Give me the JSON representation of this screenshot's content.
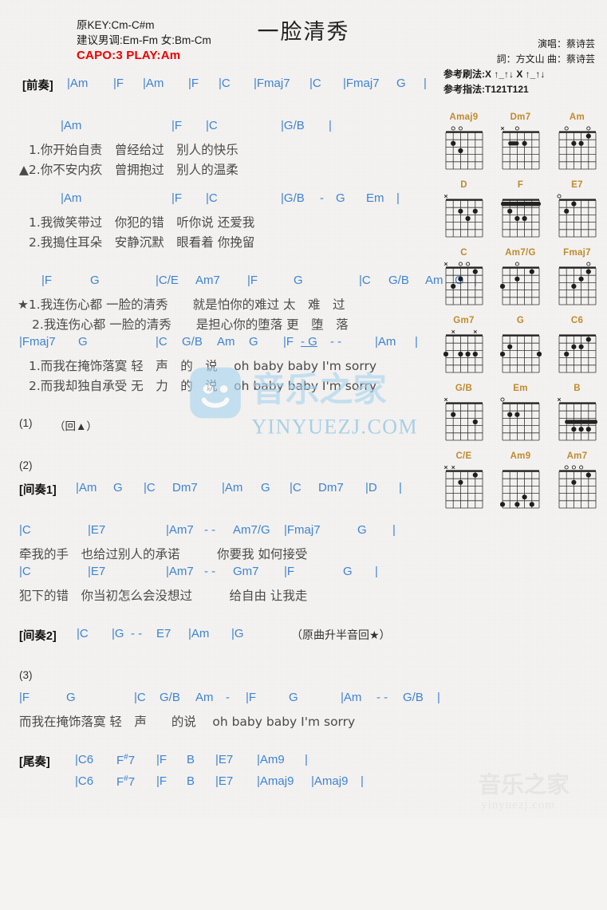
{
  "header": {
    "orig_key": "原KEY:Cm-C#m",
    "suggest_key": "建议男调:Em-Fm 女:Bm-Cm",
    "capo": "CAPO:3 PLAY:Am",
    "title": "一脸清秀",
    "singer": "演唱：蔡诗芸",
    "credits": "詞：方文山   曲：蔡诗芸",
    "strum": "参考刷法:X ↑_↑↓ X ↑_↑↓",
    "fingering": "参考指法:T121T121"
  },
  "sections": {
    "intro_label": "[前奏]",
    "interlude1_label": "[间奏1]",
    "interlude2_label": "[间奏2]",
    "outro_label": "[尾奏]",
    "repeat1": "(1)",
    "repeat1_note": "（回▲）",
    "repeat2": "(2)",
    "repeat3": "(3)",
    "interlude2_note": "（原曲升半音回★）"
  },
  "lines": {
    "intro_chords": [
      "|Am",
      "|F",
      "|Am",
      "|F",
      "|C",
      "|Fmaj7",
      "|C",
      "|Fmaj7",
      "G",
      "|"
    ],
    "v1_chords": [
      "|Am",
      "|F",
      "|C",
      "|G/B",
      "|"
    ],
    "v1_lyric1": "1.你开始自责　曾经给过　别人的快乐",
    "v1_lyric2": "▲2.你不安内疚　曾拥抱过　别人的温柔",
    "v2_chords": [
      "|Am",
      "|F",
      "|C",
      "|G/B",
      "-",
      "G",
      "Em",
      "|"
    ],
    "v2_lyric1": "1.我微笑带过　你犯的错　听你说 还爱我",
    "v2_lyric2": "2.我搗住耳朵　安静沉默　眼看着 你挽留",
    "c1_chords": [
      "|F",
      "G",
      "|C/E",
      "Am7",
      "|F",
      "G",
      "|C",
      "G/B",
      "Am",
      "G",
      "|"
    ],
    "c1_lyric1": "★1.我连伤心都 一脸的清秀　　就是怕你的难过 太　难　过",
    "c1_lyric2": "2.我连伤心都 一脸的清秀　　是担心你的堕落 更　堕　落",
    "c2_chords": [
      "|Fmaj7",
      "G",
      "|C",
      "G/B",
      "Am",
      "G",
      "|F",
      "- G",
      "- -",
      "|Am",
      "|"
    ],
    "c2_lyric1": "1.而我在掩饰落寞 轻　声　的　说　 oh baby baby I'm sorry",
    "c2_lyric2": "2.而我却独自承受 无　力　的　说　 oh baby baby I'm sorry",
    "i1_chords": [
      "|Am",
      "G",
      "|C",
      "Dm7",
      "|Am",
      "G",
      "|C",
      "Dm7",
      "|D",
      "|"
    ],
    "b1_chords": [
      "|C",
      "|E7",
      "|Am7",
      "- -",
      "Am7/G",
      "|Fmaj7",
      "G",
      "|"
    ],
    "b1_lyric": "牵我的手　也给过别人的承诺　　　你要我 如何接受",
    "b2_chords": [
      "|C",
      "|E7",
      "|Am7",
      "- -",
      "Gm7",
      "|F",
      "G",
      "|"
    ],
    "b2_lyric": "犯下的错　你当初怎么会没想过　　　给自由 让我走",
    "i2_chords": [
      "|C",
      "|G",
      "- -",
      "E7",
      "|Am",
      "|G",
      "|"
    ],
    "f_chords": [
      "|F",
      "G",
      "|C",
      "G/B",
      "Am",
      "-",
      "|F",
      "G",
      "|Am",
      "- -",
      "G/B",
      "|"
    ],
    "f_lyric": "而我在掩饰落寞 轻　声　　的说　 oh baby baby I'm sorry",
    "outro1_chords": [
      "|C6",
      "F#7",
      "|F",
      "B",
      "|E7",
      "|Am9",
      "|"
    ],
    "outro2_chords": [
      "|C6",
      "F#7",
      "|F",
      "B",
      "|E7",
      "|Amaj9",
      "|Amaj9",
      "|"
    ]
  },
  "chord_diagrams": [
    {
      "name": "Amaj9",
      "markers": "_oo__",
      "dots": [
        [
          5,
          2,
          2
        ],
        [
          4,
          3,
          1
        ]
      ],
      "barre": null
    },
    {
      "name": "Dm7",
      "markers": "x_o__",
      "dots": [
        [
          3,
          2,
          2
        ]
      ],
      "barre": {
        "fret": 1,
        "from": 1,
        "to": 2
      }
    },
    {
      "name": "Am",
      "markers": "_o__o",
      "dots": [
        [
          4,
          2,
          2
        ],
        [
          3,
          2,
          1
        ],
        [
          2,
          1,
          3
        ]
      ],
      "barre": null
    },
    {
      "name": "D",
      "markers": "x____",
      "dots": [
        [
          4,
          2,
          1
        ],
        [
          2,
          2,
          3
        ],
        [
          3,
          3,
          2
        ]
      ],
      "barre": null
    },
    {
      "name": "F",
      "markers": "_____",
      "dots": [
        [
          4,
          3,
          1
        ],
        [
          3,
          3,
          2
        ],
        [
          5,
          2,
          3
        ]
      ],
      "barre": {
        "fret": 0,
        "from": 0,
        "to": 5
      }
    },
    {
      "name": "E7",
      "markers": "o____",
      "dots": [
        [
          5,
          2,
          1
        ],
        [
          4,
          1,
          2
        ]
      ],
      "barre": null
    },
    {
      "name": "C",
      "markers": "x_oo_",
      "dots": [
        [
          5,
          3,
          1
        ],
        [
          4,
          2,
          2
        ],
        [
          2,
          1,
          3
        ]
      ],
      "barre": null
    },
    {
      "name": "Am7/G",
      "markers": "__o__",
      "dots": [
        [
          6,
          3,
          1
        ],
        [
          4,
          2,
          2
        ],
        [
          2,
          1,
          3
        ]
      ],
      "barre": null
    },
    {
      "name": "Fmaj7",
      "markers": "____o",
      "dots": [
        [
          4,
          3,
          1
        ],
        [
          3,
          2,
          2
        ],
        [
          2,
          1,
          3
        ]
      ],
      "barre": null
    },
    {
      "name": "Gm7",
      "markers": "_x__x",
      "dots": [
        [
          6,
          3,
          1
        ],
        [
          4,
          3,
          2
        ],
        [
          3,
          3,
          3
        ],
        [
          2,
          3,
          4
        ]
      ],
      "barre": null
    },
    {
      "name": "G",
      "markers": "_____",
      "dots": [
        [
          6,
          3,
          2
        ],
        [
          5,
          2,
          1
        ],
        [
          1,
          3,
          4
        ]
      ],
      "barre": null
    },
    {
      "name": "C6",
      "markers": "_____",
      "dots": [
        [
          5,
          3,
          2
        ],
        [
          4,
          2,
          2
        ],
        [
          3,
          2,
          3
        ],
        [
          2,
          1,
          4
        ]
      ],
      "barre": null
    },
    {
      "name": "G/B",
      "markers": "x____",
      "dots": [
        [
          5,
          2,
          1
        ],
        [
          2,
          3,
          2
        ]
      ],
      "barre": null
    },
    {
      "name": "Em",
      "markers": "o____",
      "dots": [
        [
          5,
          2,
          1
        ],
        [
          4,
          2,
          2
        ]
      ],
      "barre": null
    },
    {
      "name": "B",
      "markers": "x____",
      "dots": [
        [
          4,
          4,
          2
        ],
        [
          3,
          4,
          3
        ],
        [
          2,
          4,
          4
        ]
      ],
      "barre": {
        "fret": 2,
        "from": 1,
        "to": 5
      }
    },
    {
      "name": "C/E",
      "markers": "xx___",
      "dots": [
        [
          4,
          2,
          2
        ],
        [
          2,
          1,
          3
        ]
      ],
      "barre": null
    },
    {
      "name": "Am9",
      "markers": "_____",
      "dots": [
        [
          6,
          5,
          1
        ],
        [
          4,
          5,
          2
        ],
        [
          3,
          4,
          3
        ],
        [
          2,
          5,
          4
        ]
      ],
      "barre": null
    },
    {
      "name": "Am7",
      "markers": "_ooo_",
      "dots": [
        [
          4,
          2,
          1
        ],
        [
          2,
          1,
          2
        ]
      ],
      "barre": null
    }
  ],
  "watermark": {
    "center_text": "YINYUEZJ.COM",
    "corner_text": "yinyuezj.com",
    "brand": "音乐之家"
  },
  "colors": {
    "chord": "#3f83d4",
    "bar": "#6a5a3a",
    "capo": "#ee0000",
    "diagram_name": "#c08a2e",
    "lyric": "#4a4a4a"
  }
}
